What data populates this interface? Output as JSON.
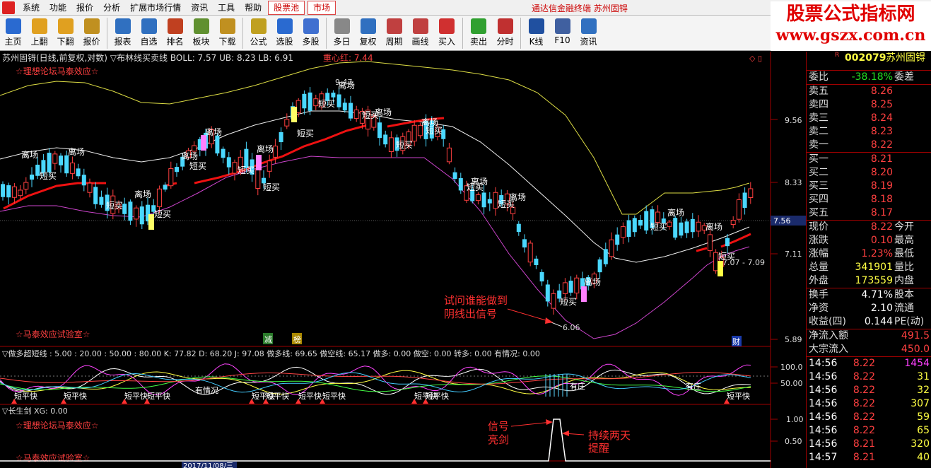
{
  "menu": {
    "items": [
      "系统",
      "功能",
      "报价",
      "分析",
      "扩展市场行情",
      "资讯",
      "工具",
      "帮助"
    ],
    "tabs": [
      "股票池",
      "市场"
    ],
    "center_title": "通达信金融终端  苏州固锝"
  },
  "toolbar": {
    "buttons": [
      "主页",
      "上翻",
      "下翻",
      "报价",
      "报表",
      "自选",
      "排名",
      "板块",
      "下载",
      "公式",
      "选股",
      "多股",
      "多日",
      "复权",
      "周期",
      "画线",
      "买入",
      "卖出",
      "分时",
      "K线",
      "F10",
      "资讯"
    ]
  },
  "brand": {
    "line1": "股票公式指标网",
    "line2": "www.gszx.com.cn"
  },
  "main": {
    "title": "苏州固锝(日线,前复权,对数) ▽布林线买卖线 BOLL: 7.57  UB: 8.23  LB: 6.91",
    "zhongxin": "重心红: 7.44",
    "watermark1": "☆理想论坛马泰效应☆",
    "watermark2": "☆马泰效应试验室☆",
    "annot_text1": "试问谁能做到",
    "annot_text2": "阴线出信号",
    "low_label": "6.06",
    "high_label": "9.47",
    "near_label": "7.07 - 7.09",
    "price_labels": [
      "9.56",
      "8.33",
      "7.11",
      "5.89"
    ],
    "cursor_price": "7.56",
    "cai": "财",
    "jian": "减",
    "bang": "榜"
  },
  "sub1": {
    "title": "▽做多超短线 : 5.00 : 20.00 : 50.00 : 80.00  K: 77.82  D: 68.20  J: 97.08  做多线: 69.65  做空线: 65.17  做多: 0.00  做空: 0.00  转多: 0.00  有情况: 0.00",
    "labels": [
      "100.0",
      "50.00"
    ],
    "duanpingkuai": "短平快",
    "youqingkuang": "有情况"
  },
  "sub2": {
    "title": "▽长生剑  XG: 0.00",
    "labels": [
      "1.00",
      "0.50"
    ],
    "watermark1": "☆理想论坛马泰效应☆",
    "watermark2": "☆马泰效应试验室☆",
    "sig1": "信号",
    "sig2": "亮剑",
    "keep1": "持续两天",
    "keep2": "提醒"
  },
  "date_axis": {
    "label": "2017/11/08/三"
  },
  "quote": {
    "code": "002079",
    "name": "苏州固锝",
    "weibi": {
      "label": "委比",
      "value": "-38.18%",
      "right": "委差"
    },
    "asks": [
      {
        "label": "卖五",
        "price": "8.26"
      },
      {
        "label": "卖四",
        "price": "8.25"
      },
      {
        "label": "卖三",
        "price": "8.24"
      },
      {
        "label": "卖二",
        "price": "8.23"
      },
      {
        "label": "卖一",
        "price": "8.22"
      }
    ],
    "bids": [
      {
        "label": "买一",
        "price": "8.21"
      },
      {
        "label": "买二",
        "price": "8.20"
      },
      {
        "label": "买三",
        "price": "8.19"
      },
      {
        "label": "买四",
        "price": "8.18"
      },
      {
        "label": "买五",
        "price": "8.17"
      }
    ],
    "stats": [
      {
        "l": "现价",
        "v": "8.22",
        "r": "今开"
      },
      {
        "l": "涨跌",
        "v": "0.10",
        "r": "最高"
      },
      {
        "l": "涨幅",
        "v": "1.23%",
        "r": "最低"
      },
      {
        "l": "总量",
        "v": "341901",
        "r": "量比"
      },
      {
        "l": "外盘",
        "v": "173559",
        "r": "内盘"
      }
    ],
    "stats2": [
      {
        "l": "换手",
        "v": "4.71%",
        "r": "股本"
      },
      {
        "l": "净资",
        "v": "2.10",
        "r": "流通"
      },
      {
        "l": "收益(四)",
        "v": "0.144",
        "r": "PE(动)"
      }
    ],
    "flows": [
      {
        "l": "净流入额",
        "v": "491.5"
      },
      {
        "l": "大宗流入",
        "v": "450.0"
      }
    ],
    "ticks": [
      {
        "t": "14:56",
        "p": "8.22",
        "v": "1454"
      },
      {
        "t": "14:56",
        "p": "8.22",
        "v": "31"
      },
      {
        "t": "14:56",
        "p": "8.22",
        "v": "32"
      },
      {
        "t": "14:56",
        "p": "8.22",
        "v": "307"
      },
      {
        "t": "14:56",
        "p": "8.22",
        "v": "59"
      },
      {
        "t": "14:56",
        "p": "8.22",
        "v": "65"
      },
      {
        "t": "14:56",
        "p": "8.21",
        "v": "320"
      },
      {
        "t": "14:57",
        "p": "8.21",
        "v": "40"
      }
    ]
  }
}
